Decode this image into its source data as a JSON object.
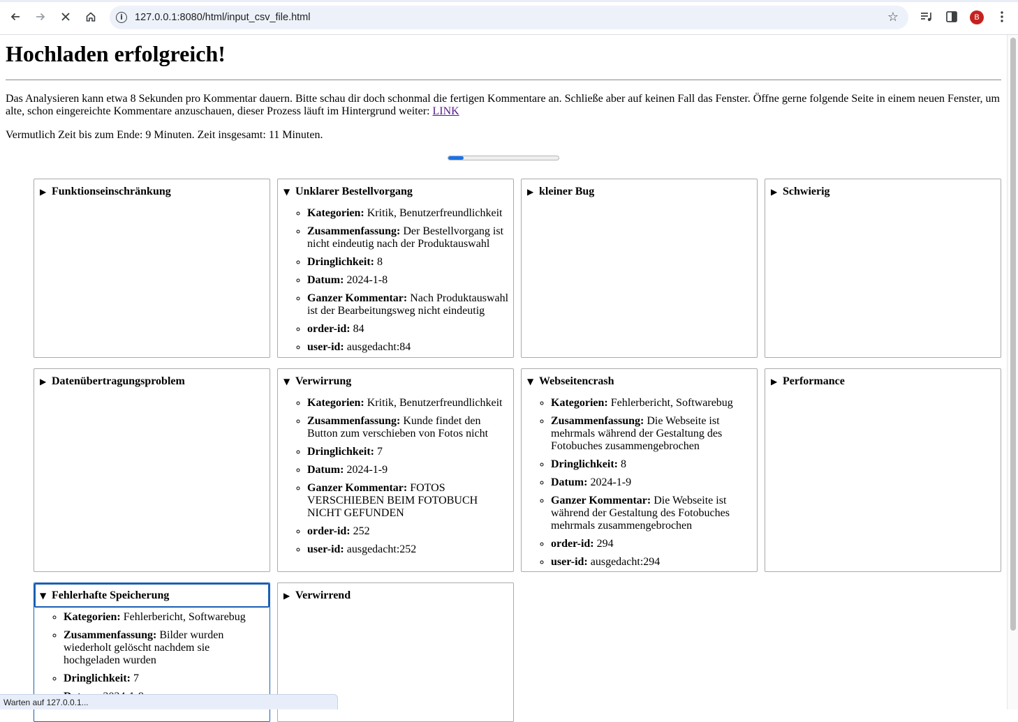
{
  "browser": {
    "url": "127.0.0.1:8080/html/input_csv_file.html",
    "profile_initial": "B",
    "status_text": "Warten auf 127.0.0.1..."
  },
  "page": {
    "title": "Hochladen erfolgreich!",
    "intro_text": "Das Analysieren kann etwa 8 Sekunden pro Kommentar dauern. Bitte schau dir doch schonmal die fertigen Kommentare an. Schließe aber auf keinen Fall das Fenster. Öffne gerne folgende Seite in einem neuen Fenster, um alte, schon eingereichte Kommentare anzuschauen, dieser Prozess läuft im Hintergrund weiter: ",
    "link_text": "LINK",
    "eta_text": "Vermutlich Zeit bis zum Ende: 9 Minuten. Zeit insgesamt: 11 Minuten.",
    "progress_percent": 14
  },
  "labels": {
    "categories": "Kategorien:",
    "summary": "Zusammenfassung:",
    "urgency": "Dringlichkeit:",
    "date": "Datum:",
    "full_comment": "Ganzer Kommentar:",
    "order_id": "order-id:",
    "user_id": "user-id:"
  },
  "cards": [
    {
      "title": "Funktionseinschränkung",
      "open": false
    },
    {
      "title": "Unklarer Bestellvorgang",
      "open": true,
      "categories": "Kritik, Benutzerfreundlichkeit",
      "summary": "Der Bestellvorgang ist nicht eindeutig nach der Produktauswahl",
      "urgency": "8",
      "date": "2024-1-8",
      "full_comment": "Nach Produktauswahl ist der Bearbeitungsweg nicht eindeutig",
      "order_id": "84",
      "user_id": "ausgedacht:84"
    },
    {
      "title": "kleiner Bug",
      "open": false
    },
    {
      "title": "Schwierig",
      "open": false
    },
    {
      "title": "Datenübertragungsproblem",
      "open": false
    },
    {
      "title": "Verwirrung",
      "open": true,
      "categories": "Kritik, Benutzerfreundlichkeit",
      "summary": "Kunde findet den Button zum verschieben von Fotos nicht",
      "urgency": "7",
      "date": "2024-1-9",
      "full_comment": "FOTOS VERSCHIEBEN BEIM FOTOBUCH NICHT GEFUNDEN",
      "order_id": "252",
      "user_id": "ausgedacht:252"
    },
    {
      "title": "Webseitencrash",
      "open": true,
      "categories": "Fehlerbericht, Softwarebug",
      "summary": "Die Webseite ist mehrmals während der Gestaltung des Fotobuches zusammengebrochen",
      "urgency": "8",
      "date": "2024-1-9",
      "full_comment": "Die Webseite ist während der Gestaltung des Fotobuches mehrmals zusammengebrochen",
      "order_id": "294",
      "user_id": "ausgedacht:294"
    },
    {
      "title": "Performance",
      "open": false
    },
    {
      "title": "Fehlerhafte Speicherung",
      "open": true,
      "categories": "Fehlerbericht, Softwarebug",
      "summary": "Bilder wurden wiederholt gelöscht nachdem sie hochgeladen wurden",
      "urgency": "7",
      "date": "2024-1-9"
    },
    {
      "title": "Verwirrend",
      "open": false
    }
  ]
}
